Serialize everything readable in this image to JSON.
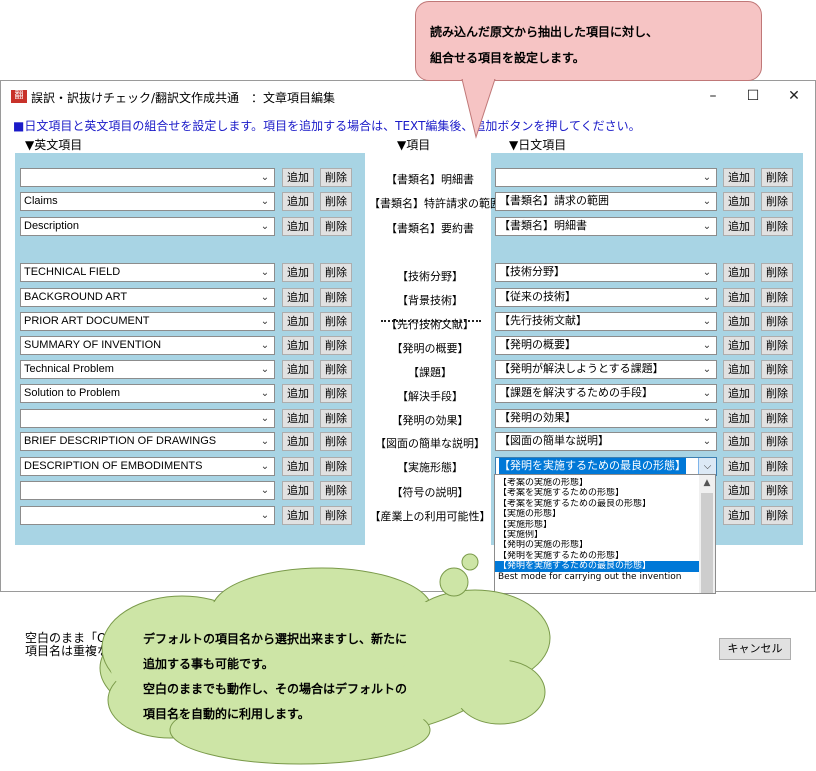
{
  "callout_top": {
    "line1": "読み込んだ原文から抽出した項目に対し、",
    "line2": "組合せる項目を設定します。"
  },
  "window": {
    "title": "誤訳・訳抜けチェック/翻訳文作成共通　：文章項目編集",
    "icon": "app-icon",
    "minimize": "–",
    "maximize": "☐",
    "close": "✕"
  },
  "instruction": "■日文項目と英文項目の組合せを設定します。項目を追加する場合は、TEXT編集後、追加ボタンを押してください。",
  "headers": {
    "english": "▼英文項目",
    "item": "▼項目",
    "japanese": "▼日文項目"
  },
  "buttons": {
    "add": "追加",
    "delete": "削除",
    "cancel": "キャンセル"
  },
  "middle_labels": [
    "【書類名】明細書",
    "【書類名】特許請求の範囲",
    "【書類名】要約書",
    "【技術分野】",
    "【背景技術】",
    "【先行技術文献】",
    "【発明の概要】",
    "【課題】",
    "【解決手段】",
    "【発明の効果】",
    "【図面の簡単な説明】",
    "【実施形態】",
    "【符号の説明】",
    "【産業上の利用可能性】"
  ],
  "english_fields": [
    "",
    "Claims",
    "Description",
    "TECHNICAL FIELD",
    "BACKGROUND ART",
    "PRIOR ART DOCUMENT",
    "SUMMARY OF INVENTION",
    "Technical Problem",
    "Solution to Problem",
    "",
    "BRIEF DESCRIPTION OF DRAWINGS",
    "DESCRIPTION OF EMBODIMENTS",
    "",
    ""
  ],
  "japanese_fields": [
    "",
    "【書類名】請求の範囲",
    "【書類名】明細書",
    "【技術分野】",
    "【従来の技術】",
    "【先行技術文献】",
    "【発明の概要】",
    "【発明が解決しようとする課題】",
    "【課題を解決するための手段】",
    "【発明の効果】",
    "【図面の簡単な説明】",
    "【発明を実施するための最良の形態】"
  ],
  "dropdown_options": [
    "【考案の実施の形態】",
    "【考案を実施するための形態】",
    "【考案を実施するための最良の形態】",
    "【実施の形態】",
    "【実施形態】",
    "【実施例】",
    "【発明の実施の形態】",
    "【発明を実施するための形態】",
    "【発明を実施するための最良の形態】",
    "Best mode for carrying out the invention"
  ],
  "dropdown_selected_index": 8,
  "note": {
    "line1": "空白のまま「OK」を押しても動作します。 ※英文項目は、大文字・小文字を区別しま",
    "line2": "項目名は重複なしの語句を設定してください。"
  },
  "cloud": {
    "line1": "デフォルトの項目名から選択出来ますし、新たに",
    "line2": "追加する事も可能です。",
    "line3": "空白のままでも動作し、その場合はデフォルトの",
    "line4": "項目名を自動的に利用します。"
  },
  "colors": {
    "panel": "#a8d4e4",
    "instruction": "#1a1ac8",
    "callout": "#f6c4c4",
    "cloud": "#cde5a6",
    "selection": "#0078d7"
  }
}
